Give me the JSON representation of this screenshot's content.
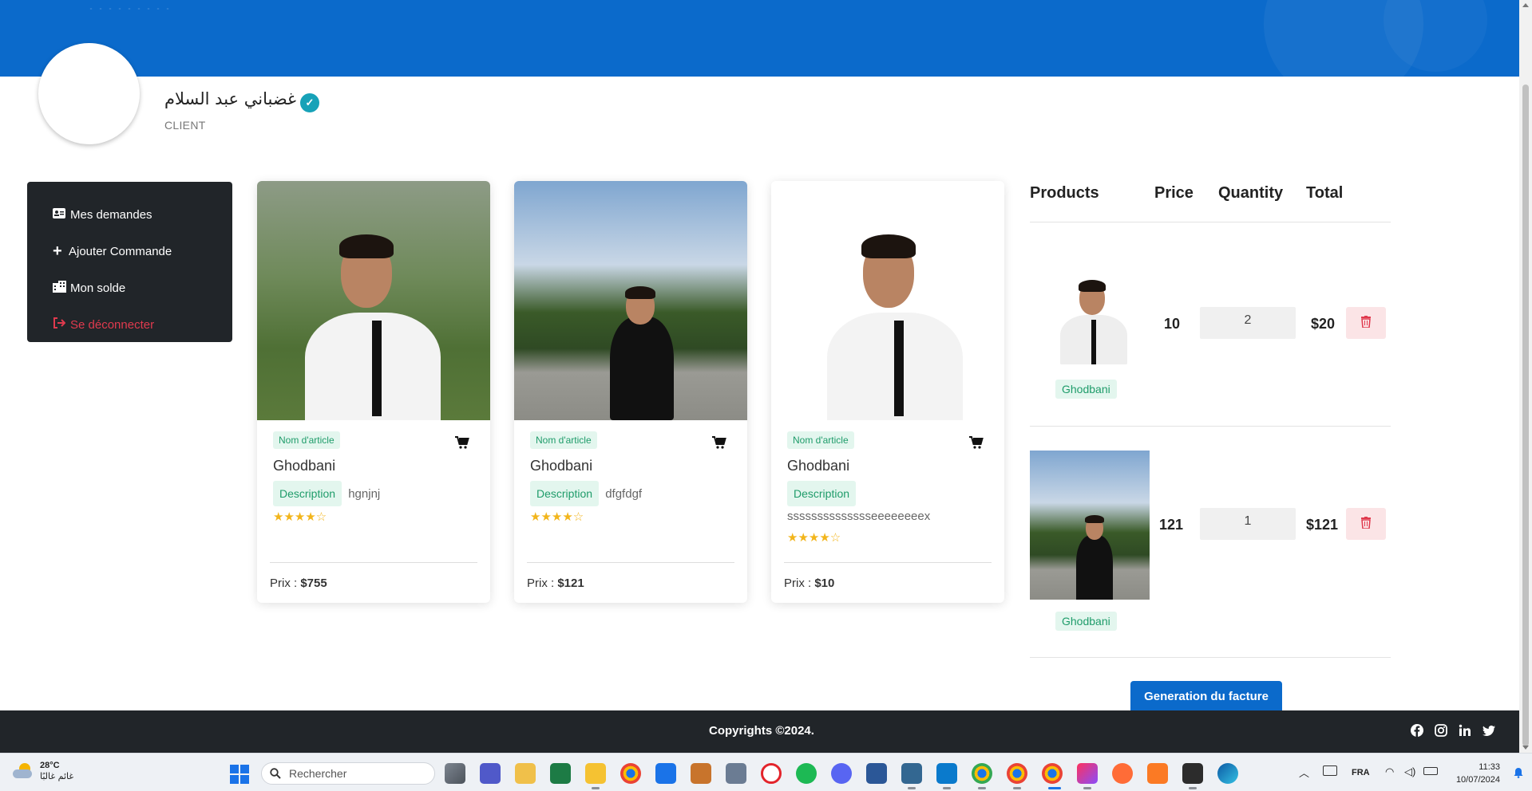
{
  "profile": {
    "name": "غضباني عبد السلام",
    "role": "CLIENT"
  },
  "sidebar": {
    "items": [
      {
        "label": "Mes demandes",
        "icon": "id-card-icon"
      },
      {
        "label": "Ajouter Commande",
        "icon": "plus-icon"
      },
      {
        "label": "Mon solde",
        "icon": "building-icon"
      },
      {
        "label": "Se déconnecter",
        "icon": "sign-out-icon"
      }
    ]
  },
  "products": [
    {
      "badge": "Nom d'article",
      "title": "Ghodbani",
      "desc_badge": "Description",
      "description": "hgnjnj",
      "stars": "★★★★☆",
      "price_label": "Prix : ",
      "price": "$755"
    },
    {
      "badge": "Nom d'article",
      "title": "Ghodbani",
      "desc_badge": "Description",
      "description": "dfgfdgf",
      "stars": "★★★★☆",
      "price_label": "Prix : ",
      "price": "$121"
    },
    {
      "badge": "Nom d'article",
      "title": "Ghodbani",
      "desc_badge": "Description",
      "description": "sssssssssssssseeeeeeeex",
      "stars": "★★★★☆",
      "price_label": "Prix : ",
      "price": "$10"
    }
  ],
  "cart": {
    "headers": [
      "Products",
      "Price",
      "Quantity",
      "Total"
    ],
    "rows": [
      {
        "name": "Ghodbani",
        "price": "10",
        "quantity": "2",
        "total": "$20"
      },
      {
        "name": "Ghodbani",
        "price": "121",
        "quantity": "1",
        "total": "$121"
      }
    ],
    "invoice_button": "Generation du facture"
  },
  "footer": {
    "copyright": "Copyrights ©2024.",
    "socials": [
      "facebook-icon",
      "instagram-icon",
      "linkedin-icon",
      "twitter-icon"
    ]
  },
  "taskbar": {
    "weather_temp": "28°C",
    "weather_desc": "غائم غالبًا",
    "search_placeholder": "Rechercher",
    "language": "FRA",
    "time": "11:33",
    "date": "10/07/2024"
  },
  "colors": {
    "brand": "#0b6acb",
    "dark": "#212529",
    "badge_bg": "#e3f6ee",
    "badge_text": "#1f9c6a",
    "danger": "#e03a4e",
    "stars": "#f2b51b"
  }
}
